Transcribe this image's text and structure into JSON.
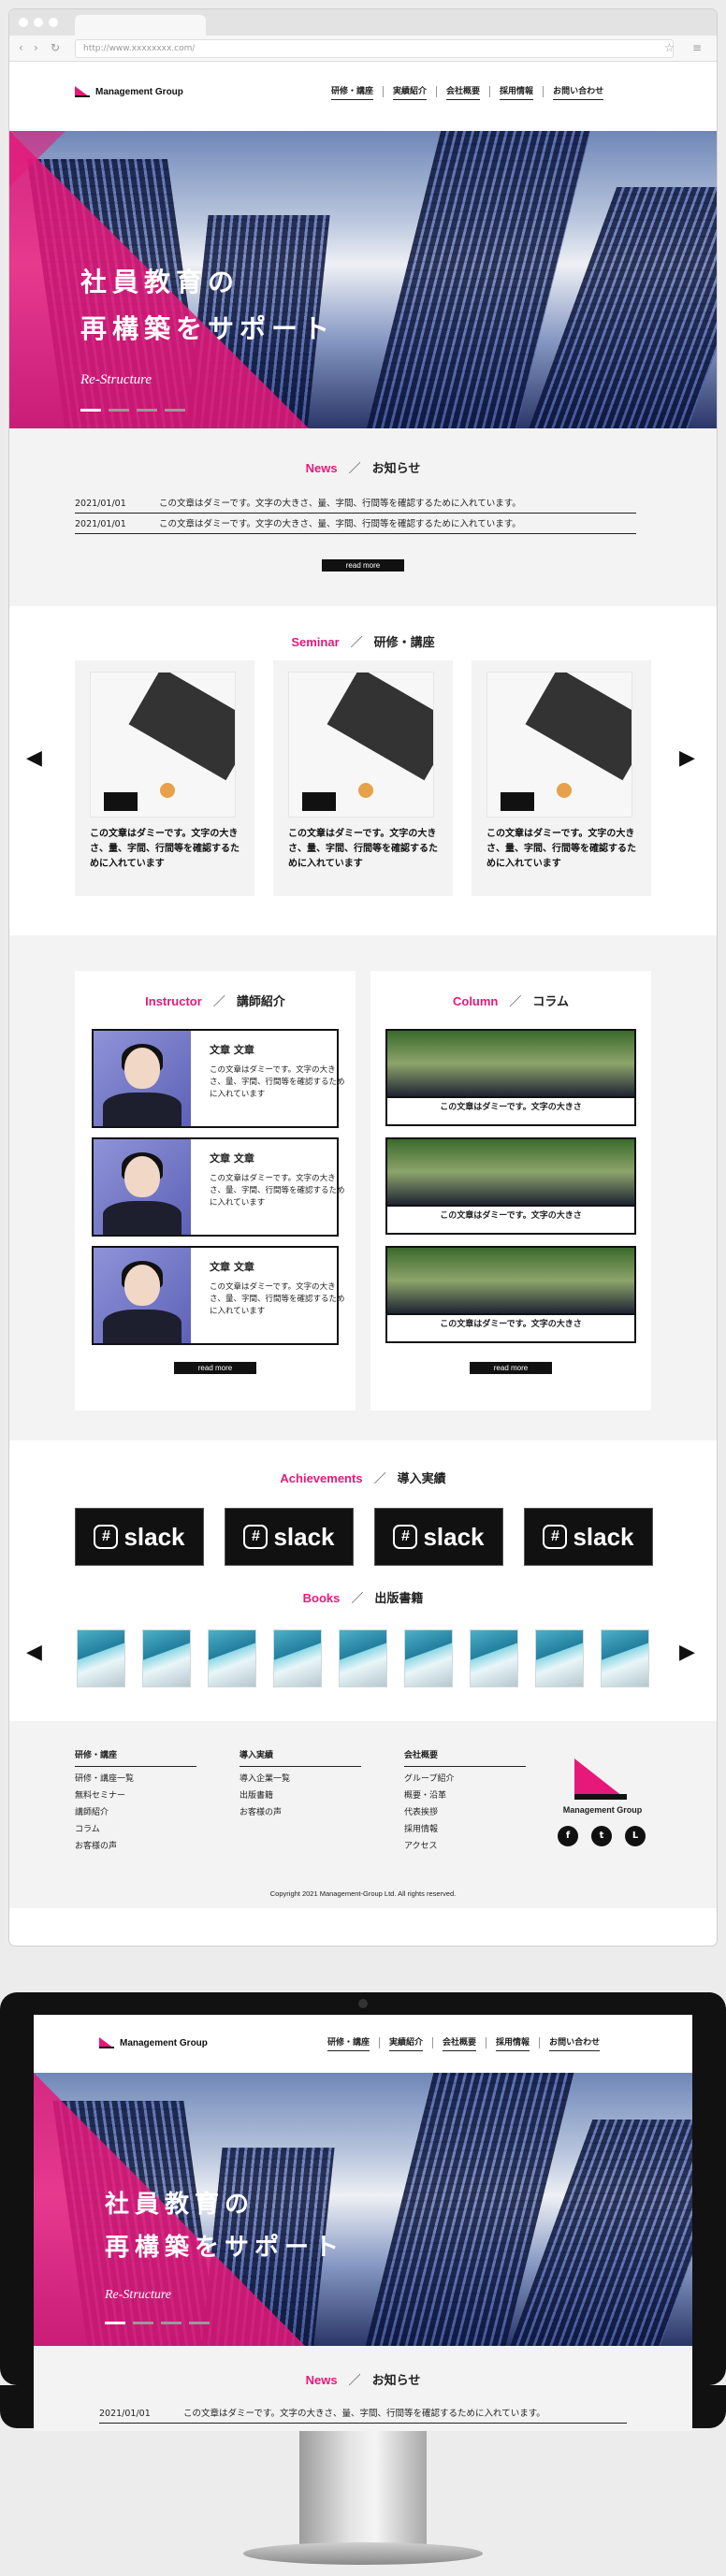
{
  "browser": {
    "url": "http://www.xxxxxxxx.com/"
  },
  "site": {
    "logo": "Management Group",
    "nav": [
      "研修・講座",
      "実績紹介",
      "会社概要",
      "採用情報",
      "お問い合わせ"
    ]
  },
  "hero": {
    "line1": "社員教育の",
    "line2": "再構築をサポート",
    "sub": "Re-Structure"
  },
  "news": {
    "title_en": "News",
    "title_ja": "お知らせ",
    "items": [
      {
        "date": "2021/01/01",
        "text": "この文章はダミーです。文字の大きさ、量、字間、行間等を確認するために入れています。"
      },
      {
        "date": "2021/01/01",
        "text": "この文章はダミーです。文字の大きさ、量、字間、行間等を確認するために入れています。"
      }
    ],
    "read_more": "read more"
  },
  "seminar": {
    "title_en": "Seminar",
    "title_ja": "研修・講座",
    "cards": [
      {
        "text": "この文章はダミーです。文字の大きさ、量、字間、行間等を確認するために入れています"
      },
      {
        "text": "この文章はダミーです。文字の大きさ、量、字間、行間等を確認するために入れています"
      },
      {
        "text": "この文章はダミーです。文字の大きさ、量、字間、行間等を確認するために入れています"
      }
    ]
  },
  "instructor": {
    "title_en": "Instructor",
    "title_ja": "講師紹介",
    "cards": [
      {
        "name": "文章 文章",
        "desc": "この文章はダミーです。文字の大きさ、量、字間、行間等を確認するために入れています"
      },
      {
        "name": "文章 文章",
        "desc": "この文章はダミーです。文字の大きさ、量、字間、行間等を確認するために入れています"
      },
      {
        "name": "文章 文章",
        "desc": "この文章はダミーです。文字の大きさ、量、字間、行間等を確認するために入れています"
      }
    ],
    "read_more": "read more"
  },
  "column": {
    "title_en": "Column",
    "title_ja": "コラム",
    "cards": [
      {
        "caption": "この文章はダミーです。文字の大きさ"
      },
      {
        "caption": "この文章はダミーです。文字の大きさ"
      },
      {
        "caption": "この文章はダミーです。文字の大きさ"
      }
    ],
    "read_more": "read more"
  },
  "achievements": {
    "title_en": "Achievements",
    "title_ja": "導入実績",
    "logos": [
      "slack",
      "slack",
      "slack",
      "slack"
    ]
  },
  "books": {
    "title_en": "Books",
    "title_ja": "出版書籍"
  },
  "footer": {
    "col1": {
      "head": "研修・講座",
      "items": [
        "研修・講座一覧",
        "無料セミナー",
        "講師紹介",
        "コラム",
        "お客様の声"
      ]
    },
    "col2": {
      "head": "導入実績",
      "items": [
        "導入企業一覧",
        "出版書籍",
        "お客様の声"
      ]
    },
    "col3": {
      "head": "会社概要",
      "items": [
        "グループ紹介",
        "概要・沿革",
        "代表挨拶",
        "採用情報",
        "アクセス"
      ]
    },
    "logo": "Management Group",
    "social": [
      "f",
      "t",
      "L"
    ],
    "copyright": "Copyright 2021 Management-Group Ltd. All rights reserved."
  },
  "monitor": {
    "news_item": {
      "date": "2021/01/01",
      "text": "この文章はダミーです。文字の大きさ、量、字間、行間等を確認するために入れています。"
    }
  }
}
